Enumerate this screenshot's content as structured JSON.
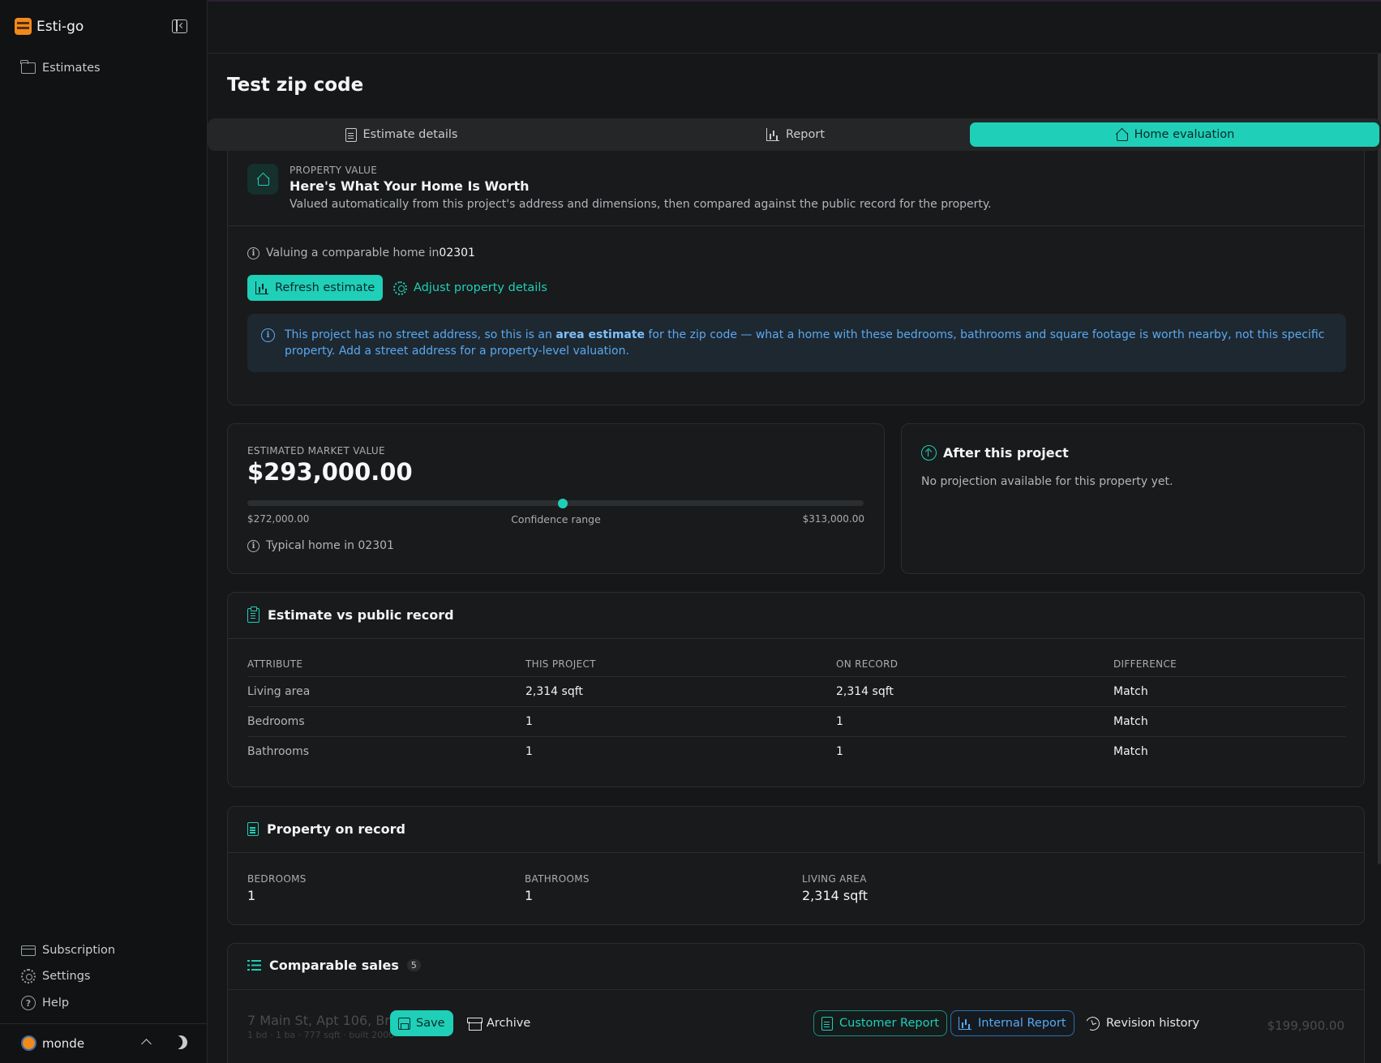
{
  "app": {
    "name": "Esti-go"
  },
  "sidebar": {
    "nav": [
      {
        "label": "Estimates",
        "icon": "folder-icon"
      }
    ],
    "bottom": [
      {
        "label": "Subscription",
        "icon": "credit-card-icon"
      },
      {
        "label": "Settings",
        "icon": "gear-icon"
      },
      {
        "label": "Help",
        "icon": "help-circle-icon"
      }
    ],
    "user": {
      "name": "monde"
    }
  },
  "page": {
    "title": "Test zip code"
  },
  "tabs": [
    {
      "label": "Estimate details",
      "icon": "document-icon",
      "active": false
    },
    {
      "label": "Report",
      "icon": "bar-chart-icon",
      "active": false
    },
    {
      "label": "Home evaluation",
      "icon": "home-icon",
      "active": true
    }
  ],
  "property_value": {
    "label": "PROPERTY VALUE",
    "heading": "Here's What Your Home Is Worth",
    "description": "Valued automatically from this project's address and dimensions, then compared against the public record for the property.",
    "valuing_prefix": "Valuing a comparable home in",
    "zip": "02301",
    "refresh_label": "Refresh estimate",
    "adjust_label": "Adjust property details",
    "notice_part1": "This project has no street address, so this is an ",
    "notice_bold": "area estimate",
    "notice_part2": " for the zip code — what a home with these bedrooms, bathrooms and square footage is worth nearby, not this specific property. Add a street address for a property-level valuation."
  },
  "market_value": {
    "label": "ESTIMATED MARKET VALUE",
    "value": "$293,000.00",
    "low": "$272,000.00",
    "high": "$313,000.00",
    "range_label": "Confidence range",
    "position_fraction": 0.512,
    "typical_text": "Typical home in 02301"
  },
  "after_project": {
    "title": "After this project",
    "description": "No projection available for this property yet."
  },
  "comparison": {
    "title": "Estimate vs public record",
    "headers": [
      "ATTRIBUTE",
      "THIS PROJECT",
      "ON RECORD",
      "DIFFERENCE"
    ],
    "rows": [
      [
        "Living area",
        "2,314 sqft",
        "2,314 sqft",
        "Match"
      ],
      [
        "Bedrooms",
        "1",
        "1",
        "Match"
      ],
      [
        "Bathrooms",
        "1",
        "1",
        "Match"
      ]
    ]
  },
  "property_record": {
    "title": "Property on record",
    "items": [
      {
        "label": "BEDROOMS",
        "value": "1"
      },
      {
        "label": "BATHROOMS",
        "value": "1"
      },
      {
        "label": "LIVING AREA",
        "value": "2,314 sqft"
      }
    ]
  },
  "comparable_sales": {
    "title": "Comparable sales",
    "count": "5",
    "first_address": "7 Main St, Apt 106, Bro",
    "first_details": "1 bd · 1 ba · 777 sqft · built 2000",
    "first_price": "$199,900.00"
  },
  "bottom_bar": {
    "save": "Save",
    "archive": "Archive",
    "customer_report": "Customer Report",
    "internal_report": "Internal Report",
    "revision_history": "Revision history"
  },
  "colors": {
    "accent": "#1fcfb8",
    "info": "#5aa8f0",
    "background": "#161718"
  }
}
